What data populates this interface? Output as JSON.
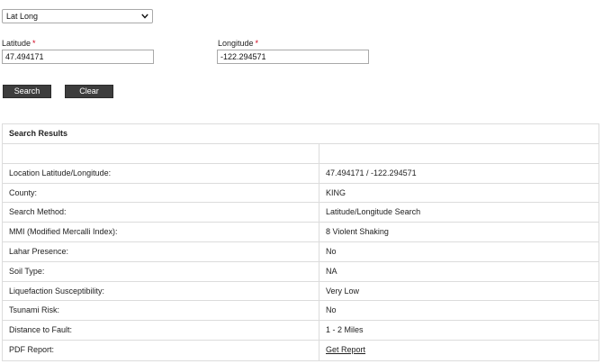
{
  "search_type": {
    "selected": "Lat Long"
  },
  "form": {
    "latitude_label": "Latitude",
    "latitude_value": "47.494171",
    "longitude_label": "Longitude",
    "longitude_value": "-122.294571",
    "required_marker": "*",
    "search_label": "Search",
    "clear_label": "Clear"
  },
  "results": {
    "title": "Search Results",
    "rows": [
      {
        "label": "",
        "value": ""
      },
      {
        "label": "Location Latitude/Longitude:",
        "value": "47.494171 / -122.294571"
      },
      {
        "label": "County:",
        "value": "KING"
      },
      {
        "label": "Search Method:",
        "value": "Latitude/Longitude Search"
      },
      {
        "label": "MMI (Modified Mercalli Index):",
        "value": "8 Violent Shaking"
      },
      {
        "label": "Lahar Presence:",
        "value": "No"
      },
      {
        "label": "Soil Type:",
        "value": "NA"
      },
      {
        "label": "Liquefaction Susceptibility:",
        "value": "Very Low"
      },
      {
        "label": "Tsunami Risk:",
        "value": "No"
      },
      {
        "label": "Distance to Fault:",
        "value": "1 - 2 Miles"
      },
      {
        "label": "PDF Report:",
        "value": "Get Report"
      }
    ]
  }
}
